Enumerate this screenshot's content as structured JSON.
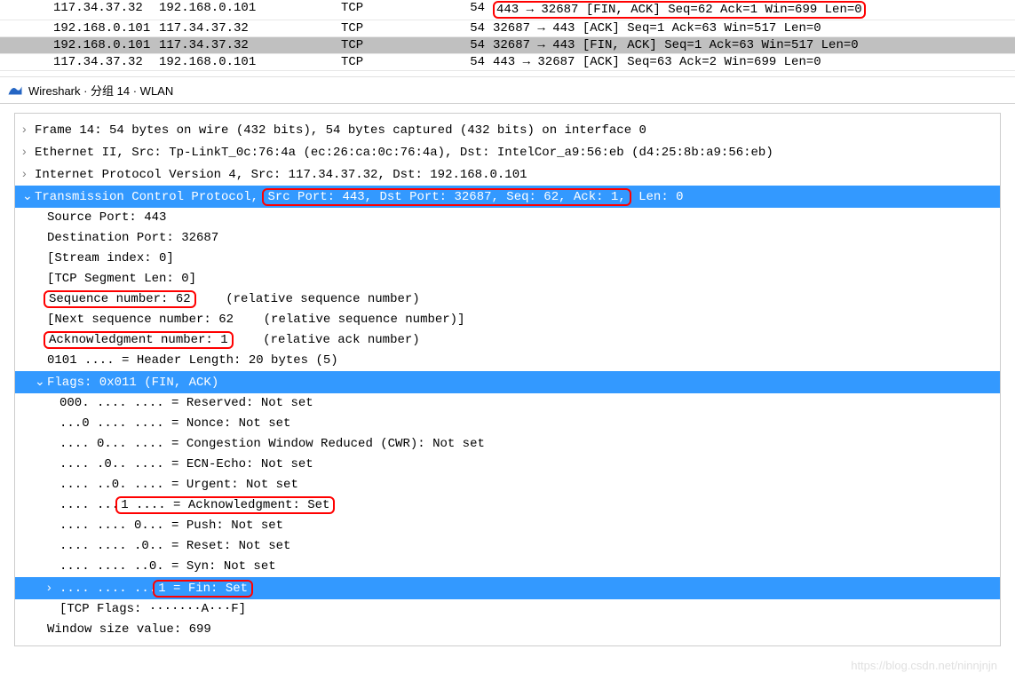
{
  "packets": [
    {
      "src": "117.34.37.32",
      "dst": "192.168.0.101",
      "proto": "TCP",
      "len": "54",
      "info": "443 → 32687 [FIN, ACK] Seq=62 Ack=1 Win=699 Len=0",
      "hl": true,
      "gray": false
    },
    {
      "src": "192.168.0.101",
      "dst": "117.34.37.32",
      "proto": "TCP",
      "len": "54",
      "info": "32687 → 443 [ACK] Seq=1 Ack=63 Win=517 Len=0",
      "hl": false,
      "gray": false
    },
    {
      "src": "192.168.0.101",
      "dst": "117.34.37.32",
      "proto": "TCP",
      "len": "54",
      "info": "32687 → 443 [FIN, ACK] Seq=1 Ack=63 Win=517 Len=0",
      "hl": false,
      "gray": true
    },
    {
      "src": "117.34.37.32",
      "dst": "192.168.0.101",
      "proto": "TCP",
      "len": "54",
      "info": "443 → 32687 [ACK] Seq=63 Ack=2 Win=699 Len=0",
      "hl": false,
      "gray": false
    }
  ],
  "window": {
    "title": "Wireshark · 分组 14 · WLAN"
  },
  "details": {
    "frame": "Frame 14: 54 bytes on wire (432 bits), 54 bytes captured (432 bits) on interface 0",
    "eth": "Ethernet II, Src: Tp-LinkT_0c:76:4a (ec:26:ca:0c:76:4a), Dst: IntelCor_a9:56:eb (d4:25:8b:a9:56:eb)",
    "ip": "Internet Protocol Version 4, Src: 117.34.37.32, Dst: 192.168.0.101",
    "tcp_prefix": "Transmission Control Protocol, ",
    "tcp_hl": "Src Port: 443, Dst Port: 32687, Seq: 62, Ack: 1,",
    "tcp_suffix": " Len: 0",
    "src_port": "Source Port: 443",
    "dst_port": "Destination Port: 32687",
    "stream": "[Stream index: 0]",
    "seglen": "[TCP Segment Len: 0]",
    "seq_hl": "Sequence number: 62",
    "seq_suffix": "    (relative sequence number)",
    "nextseq": "[Next sequence number: 62    (relative sequence number)]",
    "ack_hl": "Acknowledgment number: 1",
    "ack_suffix": "    (relative ack number)",
    "hdrlen": "0101 .... = Header Length: 20 bytes (5)",
    "flags": "Flags: 0x011 (FIN, ACK)",
    "flag_lines": [
      "000. .... .... = Reserved: Not set",
      "...0 .... .... = Nonce: Not set",
      ".... 0... .... = Congestion Window Reduced (CWR): Not set",
      ".... .0.. .... = ECN-Echo: Not set",
      ".... ..0. .... = Urgent: Not set"
    ],
    "flag_ack_pre": ".... ...",
    "flag_ack_hl": "1 .... = Acknowledgment: Set",
    "flag_lines2": [
      ".... .... 0... = Push: Not set",
      ".... .... .0.. = Reset: Not set",
      ".... .... ..0. = Syn: Not set"
    ],
    "flag_fin_pre": ".... .... ...",
    "flag_fin_hl": "1 = Fin: Set",
    "tcp_flags_str": "[TCP Flags: ·······A···F]",
    "win": "Window size value: 699"
  },
  "watermark": "https://blog.csdn.net/ninnjnjn"
}
